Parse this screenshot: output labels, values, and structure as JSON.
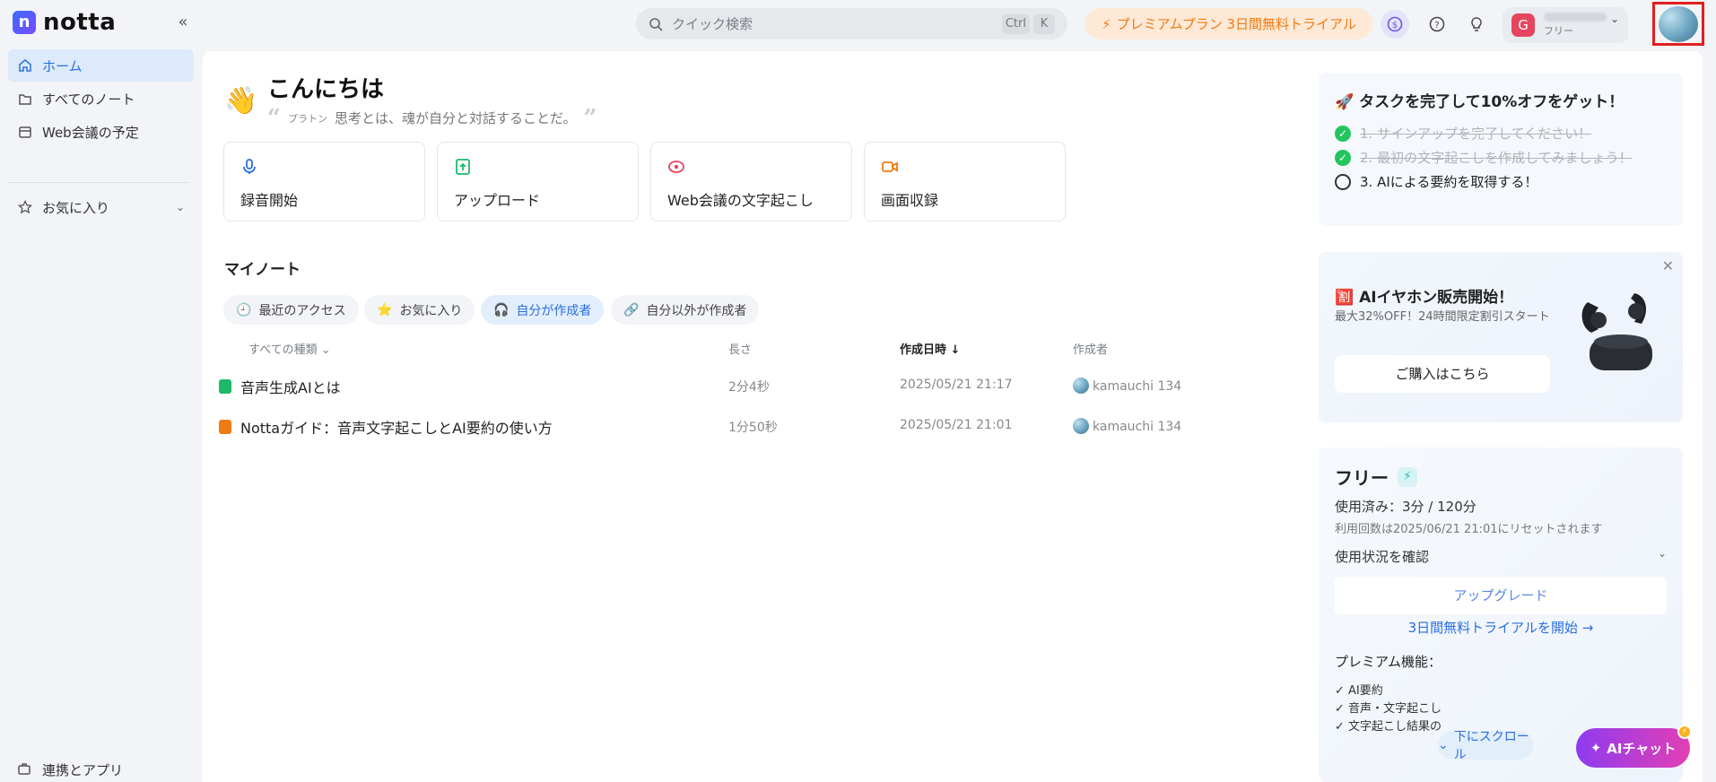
{
  "app": {
    "logo_text": "notta"
  },
  "topbar": {
    "search_placeholder": "クイック検索",
    "shortcut_ctrl": "Ctrl",
    "shortcut_k": "K",
    "premium_label": "プレミアムプラン 3日間無料トライアル",
    "account_plan": "フリー",
    "account_initial": "G"
  },
  "sidebar": {
    "items": [
      {
        "label": "ホーム"
      },
      {
        "label": "すべてのノート"
      },
      {
        "label": "Web会議の予定"
      },
      {
        "label": "お気に入り"
      }
    ],
    "bottom_label": "連携とアプリ"
  },
  "main": {
    "greeting": "こんにちは",
    "quote_author": "プラトン",
    "quote_text": "思考とは、魂が自分と対話することだ。",
    "actions": [
      {
        "label": "録音開始"
      },
      {
        "label": "アップロード"
      },
      {
        "label": "Web会議の文字起こし"
      },
      {
        "label": "画面収録"
      }
    ],
    "section_title": "マイノート",
    "filters": [
      {
        "label": "最近のアクセス"
      },
      {
        "label": "お気に入り"
      },
      {
        "label": "自分が作成者"
      },
      {
        "label": "自分以外が作成者"
      }
    ],
    "columns": {
      "type": "すべての種類",
      "length": "長さ",
      "created": "作成日時",
      "author": "作成者"
    },
    "notes": [
      {
        "title": "音声生成AIとは",
        "length": "2分4秒",
        "created": "2025/05/21 21:17",
        "author": "kamauchi 134"
      },
      {
        "title": "Nottaガイド：音声文字起こしとAI要約の使い方",
        "length": "1分50秒",
        "created": "2025/05/21 21:01",
        "author": "kamauchi 134"
      }
    ]
  },
  "tasks": {
    "title": "タスクを完了して10%オフをゲット！",
    "items": [
      {
        "label": "1. サインアップを完了してください！"
      },
      {
        "label": "2. 最初の文字起こしを作成してみましょう！"
      },
      {
        "label": "3. AIによる要約を取得する！"
      }
    ]
  },
  "promo": {
    "title": "AIイヤホン販売開始！",
    "subtitle": "最大32%OFF！24時間限定割引スタート",
    "button": "ご購入はこちら"
  },
  "plan": {
    "title": "フリー",
    "usage": "使用済み：3分 / 120分",
    "reset": "利用回数は2025/06/21 21:01にリセットされます",
    "check_usage": "使用状況を確認",
    "upgrade": "アップグレード",
    "trial": "3日間無料トライアルを開始 →",
    "features_title": "プレミアム機能：",
    "features": [
      "AI要約",
      "音声・文字起こし",
      "文字起こし結果の"
    ]
  },
  "floating": {
    "scroll_label": "下にスクロール",
    "ai_chat_label": "AIチャット"
  },
  "colors": {
    "accent": "#2a6fe0",
    "premium": "#f07a13",
    "done": "#22c55e",
    "ai_gradient_start": "#8f3bf0",
    "ai_gradient_end": "#e23fb3"
  }
}
